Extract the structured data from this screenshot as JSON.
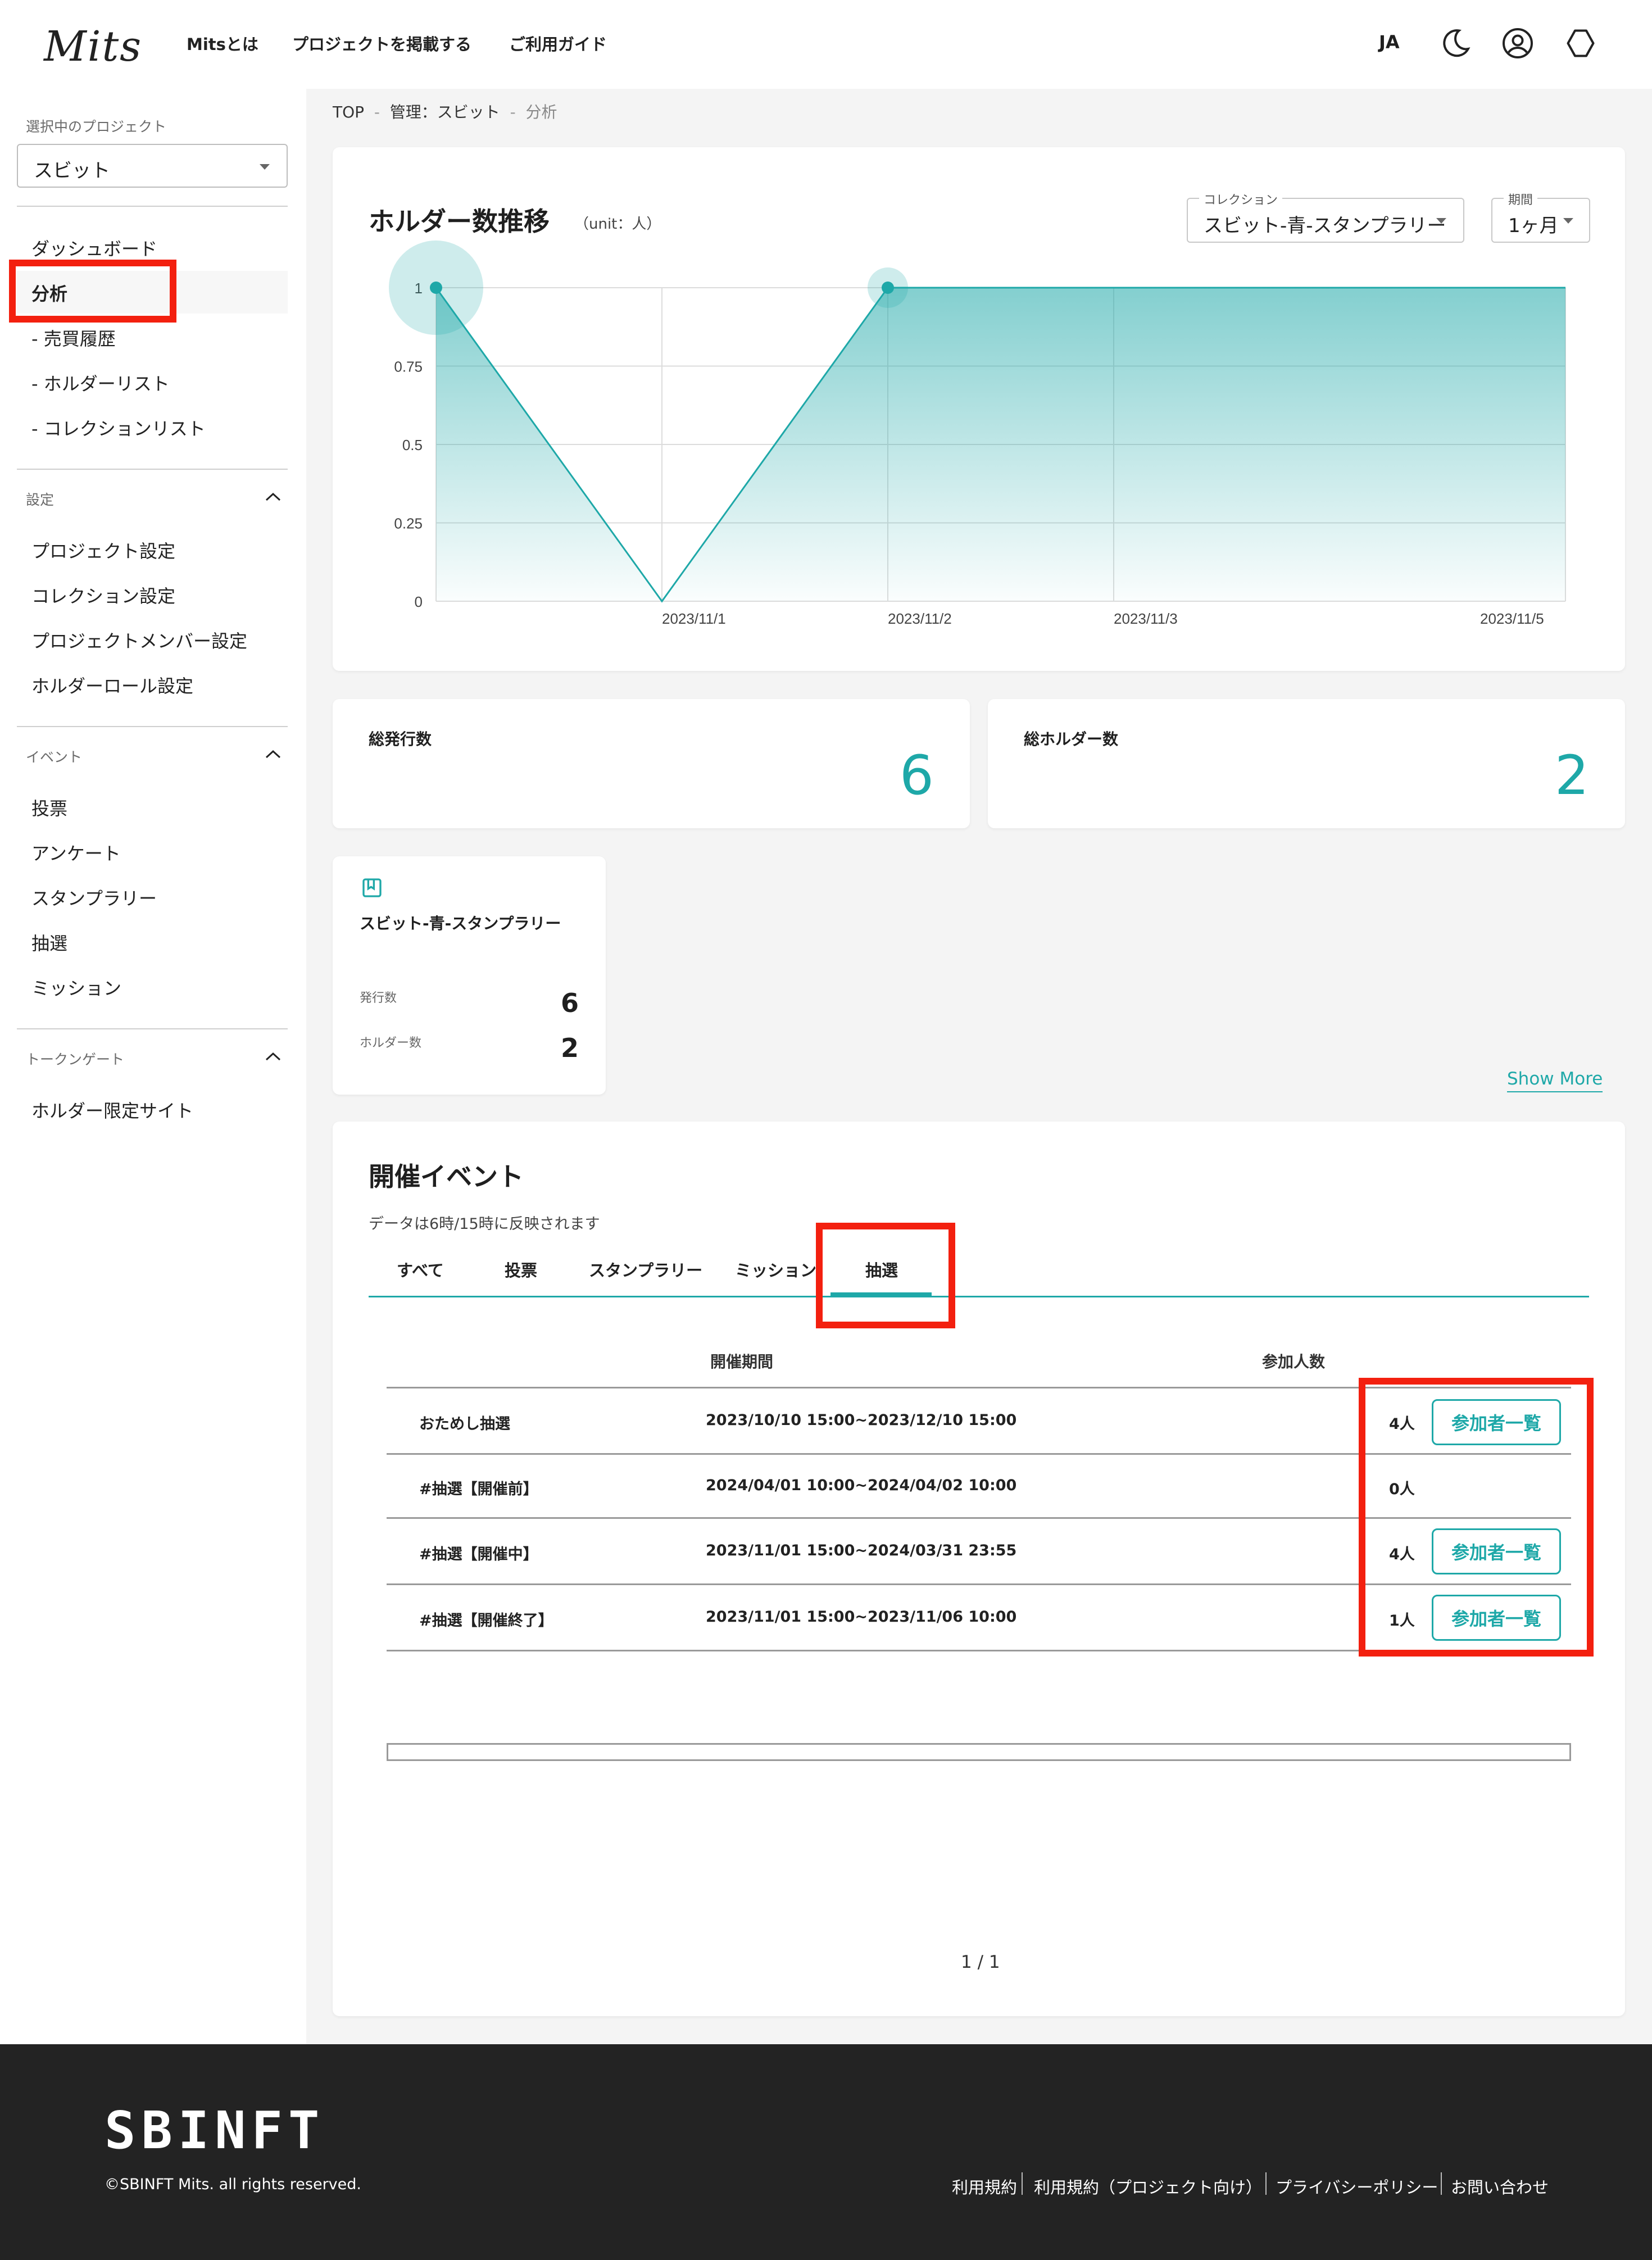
{
  "header": {
    "logo": "Mits",
    "nav": [
      "Mitsとは",
      "プロジェクトを掲載する",
      "ご利用ガイド"
    ],
    "lang": "JA"
  },
  "sidebar": {
    "project_label": "選択中のプロジェクト",
    "project_value": "スビット",
    "main_items": [
      "ダッシュボード",
      "分析",
      "- 売買履歴",
      "- ホルダーリスト",
      "- コレクションリスト"
    ],
    "settings_label": "設定",
    "settings_items": [
      "プロジェクト設定",
      "コレクション設定",
      "プロジェクトメンバー設定",
      "ホルダーロール設定"
    ],
    "events_label": "イベント",
    "events_items": [
      "投票",
      "アンケート",
      "スタンプラリー",
      "抽選",
      "ミッション"
    ],
    "tokengate_label": "トークンゲート",
    "tokengate_items": [
      "ホルダー限定サイト"
    ]
  },
  "breadcrumb": [
    "TOP",
    "管理：スビット",
    "分析"
  ],
  "chart_card": {
    "title": "ホルダー数推移",
    "unit": "（unit：人）",
    "collection_label": "コレクション",
    "collection_value": "スビット-青-スタンプラリー",
    "period_label": "期間",
    "period_value": "1ヶ月"
  },
  "chart_data": {
    "type": "area",
    "x": [
      "2023/10/31",
      "2023/11/1",
      "2023/11/2",
      "2023/11/3",
      "2023/11/4",
      "2023/11/5"
    ],
    "x_tick_labels": [
      "2023/11/1",
      "2023/11/2",
      "2023/11/3",
      "2023/11/5"
    ],
    "values": [
      1,
      0,
      1,
      1,
      1,
      1
    ],
    "y_ticks": [
      "0",
      "0.25",
      "0.5",
      "0.75",
      "1"
    ],
    "ylim": [
      0,
      1
    ],
    "grid": true,
    "color": "#1ea8a8"
  },
  "stats": {
    "total_issued_label": "総発行数",
    "total_issued_value": "6",
    "total_holders_label": "総ホルダー数",
    "total_holders_value": "2"
  },
  "collection_card": {
    "name": "スビット-青-スタンプラリー",
    "issued_label": "発行数",
    "issued_value": "6",
    "holders_label": "ホルダー数",
    "holders_value": "2"
  },
  "show_more": "Show More",
  "events": {
    "title": "開催イベント",
    "note": "データは6時/15時に反映されます",
    "tabs": [
      "すべて",
      "投票",
      "スタンプラリー",
      "ミッション",
      "抽選"
    ],
    "columns": [
      "開催期間",
      "参加人数"
    ],
    "rows": [
      {
        "name": "おためし抽選",
        "period": "2023/10/10 15:00~2023/12/10 15:00",
        "count": "4人",
        "button": "参加者一覧"
      },
      {
        "name": "#抽選【開催前】",
        "period": "2024/04/01 10:00~2024/04/02 10:00",
        "count": "0人",
        "button": ""
      },
      {
        "name": "#抽選【開催中】",
        "period": "2023/11/01 15:00~2024/03/31 23:55",
        "count": "4人",
        "button": "参加者一覧"
      },
      {
        "name": "#抽選【開催終了】",
        "period": "2023/11/01 15:00~2023/11/06 10:00",
        "count": "1人",
        "button": "参加者一覧"
      }
    ],
    "pagination": "1 / 1"
  },
  "footer": {
    "logo": "SBINFT",
    "copyright": "©SBINFT Mits. all rights reserved.",
    "links": [
      "利用規約",
      "利用規約（プロジェクト向け）",
      "プライバシーポリシー",
      "お問い合わせ"
    ]
  },
  "colors": {
    "accent": "#1ea8a8",
    "highlight": "#f3200f",
    "footer_bg": "#232323"
  }
}
